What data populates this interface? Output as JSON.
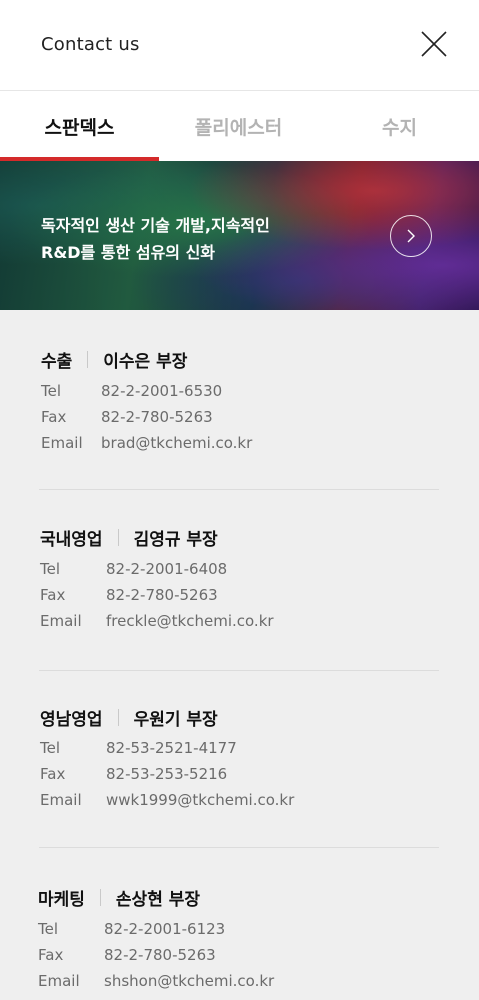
{
  "header": {
    "title": "Contact us",
    "close_icon": "close-icon"
  },
  "tabs": [
    {
      "label": "스판덱스",
      "active": true
    },
    {
      "label": "폴리에스터",
      "active": false
    },
    {
      "label": "수지",
      "active": false
    }
  ],
  "banner": {
    "line1": "독자적인 생산 기술 개발,지속적인",
    "line2": "R&D를 통한 섬유의 신화",
    "next_icon": "chevron-right-icon"
  },
  "contacts": [
    {
      "dept": "수출",
      "person": "이수은 부장",
      "tel_label": "Tel",
      "tel": "82-2-2001-6530",
      "fax_label": "Fax",
      "fax": "82-2-780-5263",
      "email_label": "Email",
      "email": "brad@tkchemi.co.kr"
    },
    {
      "dept": "국내영업",
      "person": "김영규 부장",
      "tel_label": "Tel",
      "tel": "82-2-2001-6408",
      "fax_label": "Fax",
      "fax": "82-2-780-5263",
      "email_label": "Email",
      "email": "freckle@tkchemi.co.kr"
    },
    {
      "dept": "영남영업",
      "person": "우원기 부장",
      "tel_label": "Tel",
      "tel": "82-53-2521-4177",
      "fax_label": "Fax",
      "fax": "82-53-253-5216",
      "email_label": "Email",
      "email": "wwk1999@tkchemi.co.kr"
    },
    {
      "dept": "마케팅",
      "person": "손상현 부장",
      "tel_label": "Tel",
      "tel": "82-2-2001-6123",
      "fax_label": "Fax",
      "fax": "82-2-780-5263",
      "email_label": "Email",
      "email": "shshon@tkchemi.co.kr"
    }
  ],
  "colors": {
    "accent": "#d42a2a",
    "background": "#efefef"
  }
}
